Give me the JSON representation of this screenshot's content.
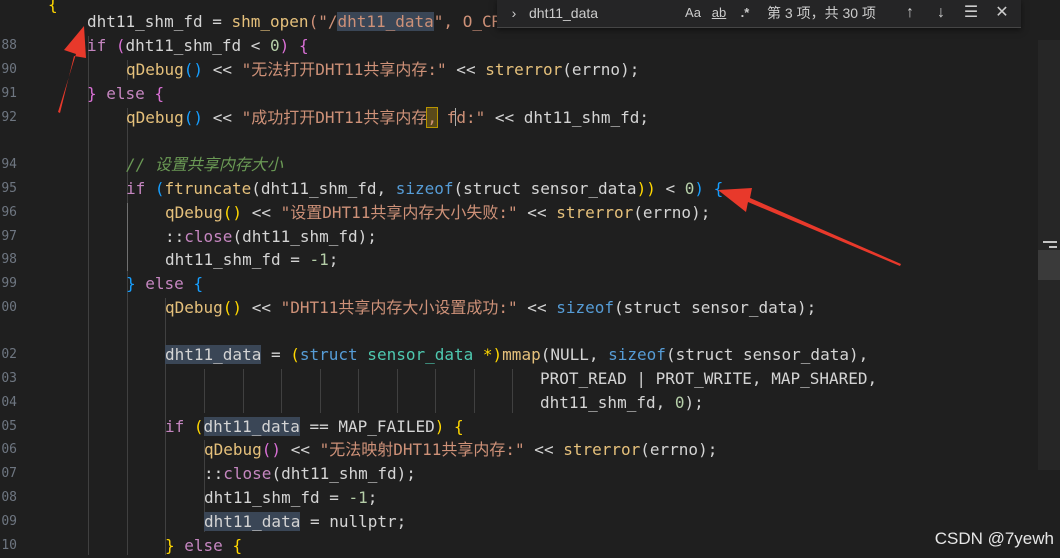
{
  "editor": {
    "line_numbers": [
      "",
      "88",
      "90",
      "91",
      "92",
      "",
      "94",
      "95",
      "96",
      "97",
      "98",
      "99",
      "00",
      "",
      "02",
      "03",
      "04",
      "05",
      "06",
      "07",
      "08",
      "09",
      "10"
    ],
    "tokens": {
      "l0_brace": "{",
      "l1_a": "dht11_shm_fd",
      "l1_b": " = ",
      "l1_c": "shm_open",
      "l1_d": "(\"/",
      "l1_e": "dht11_data",
      "l1_f": "\", O_CR",
      "l2_if": "if",
      "l2_a": " (",
      "l2_b": "dht11_shm_fd",
      "l2_c": " < ",
      "l2_d": "0",
      "l2_e": ")",
      "l2_f": " {",
      "l3_a": "qDebug",
      "l3_b": "()",
      "l3_c": " << ",
      "l3_d": "\"无法打开DHT11共享内存:\"",
      "l3_e": " << ",
      "l3_f": "strerror",
      "l3_g": "(errno);",
      "l4_a": "}",
      "l4_b": " else ",
      "l4_c": "{",
      "l5_a": "qDebug",
      "l5_b": "()",
      "l5_c": " << ",
      "l5_d1": "\"成功打开DHT11共享内存",
      "l5_d2": ",",
      "l5_d3": " fd:\"",
      "l5_e": " << ",
      "l5_f": "dht11_shm_fd;",
      "l6_cmt": "// 设置共享内存大小",
      "l7_if": "if",
      "l7_a": " (",
      "l7_b": "ftruncate",
      "l7_c": "(dht11_shm_fd, ",
      "l7_d": "sizeof",
      "l7_e": "(struct ",
      "l7_f": "sensor_data",
      "l7_g": "))",
      "l7_h": " < ",
      "l7_i": "0",
      "l7_j": ")",
      "l7_k": " {",
      "l8_a": "qDebug",
      "l8_b": "()",
      "l8_c": " << ",
      "l8_d": "\"设置DHT11共享内存大小失败:\"",
      "l8_e": " << ",
      "l8_f": "strerror",
      "l8_g": "(errno);",
      "l9_a": "::",
      "l9_b": "close",
      "l9_c": "(dht11_shm_fd);",
      "l10_a": "dht11_shm_fd = ",
      "l10_b": "-1",
      "l10_c": ";",
      "l11_a": "}",
      "l11_b": " else ",
      "l11_c": "{",
      "l12_a": "qDebug",
      "l12_b": "()",
      "l12_c": " << ",
      "l12_d": "\"DHT11共享内存大小设置成功:\"",
      "l12_e": " << ",
      "l12_f": "sizeof",
      "l12_g": "(struct sensor_data);",
      "l14_a": "dht11_data",
      "l14_b": " = ",
      "l14_c": "(",
      "l14_d": "struct",
      "l14_e": " sensor_data",
      "l14_f": " *)",
      "l14_g": "mmap",
      "l14_h": "(NULL, ",
      "l14_i": "sizeof",
      "l14_j": "(struct sensor_data),",
      "l15_a": "PROT_READ | PROT_WRITE, MAP_SHARED,",
      "l16_a": "dht11_shm_fd, ",
      "l16_b": "0",
      "l16_c": ");",
      "l17_if": "if",
      "l17_a": " (",
      "l17_b": "dht11_data",
      "l17_c": " == MAP_FAILED",
      "l17_d": ")",
      "l17_e": " {",
      "l18_a": "qDebug",
      "l18_b": "()",
      "l18_c": " << ",
      "l18_d": "\"无法映射DHT11共享内存:\"",
      "l18_e": " << ",
      "l18_f": "strerror",
      "l18_g": "(errno);",
      "l19_a": "::",
      "l19_b": "close",
      "l19_c": "(dht11_shm_fd);",
      "l20_a": "dht11_shm_fd = ",
      "l20_b": "-1",
      "l20_c": ";",
      "l21_a": "dht11_data",
      "l21_b": " = nullptr;",
      "l22_a": "}",
      "l22_b": " else ",
      "l22_c": "{"
    }
  },
  "find_widget": {
    "toggle_icon": "chevron-right-icon",
    "toggle_glyph": "›",
    "query": "dht11_data",
    "match_case": "Aa",
    "match_word": "ab",
    "regex": ".*",
    "count": "第 3 项，共 30 项",
    "prev_glyph": "↑",
    "next_glyph": "↓",
    "selection_glyph": "☰",
    "close_glyph": "✕"
  },
  "watermark": "CSDN @7yewh",
  "colors": {
    "background": "#1f1f1f",
    "arrow": "#e8392b",
    "find_highlight": "#3a4656"
  }
}
